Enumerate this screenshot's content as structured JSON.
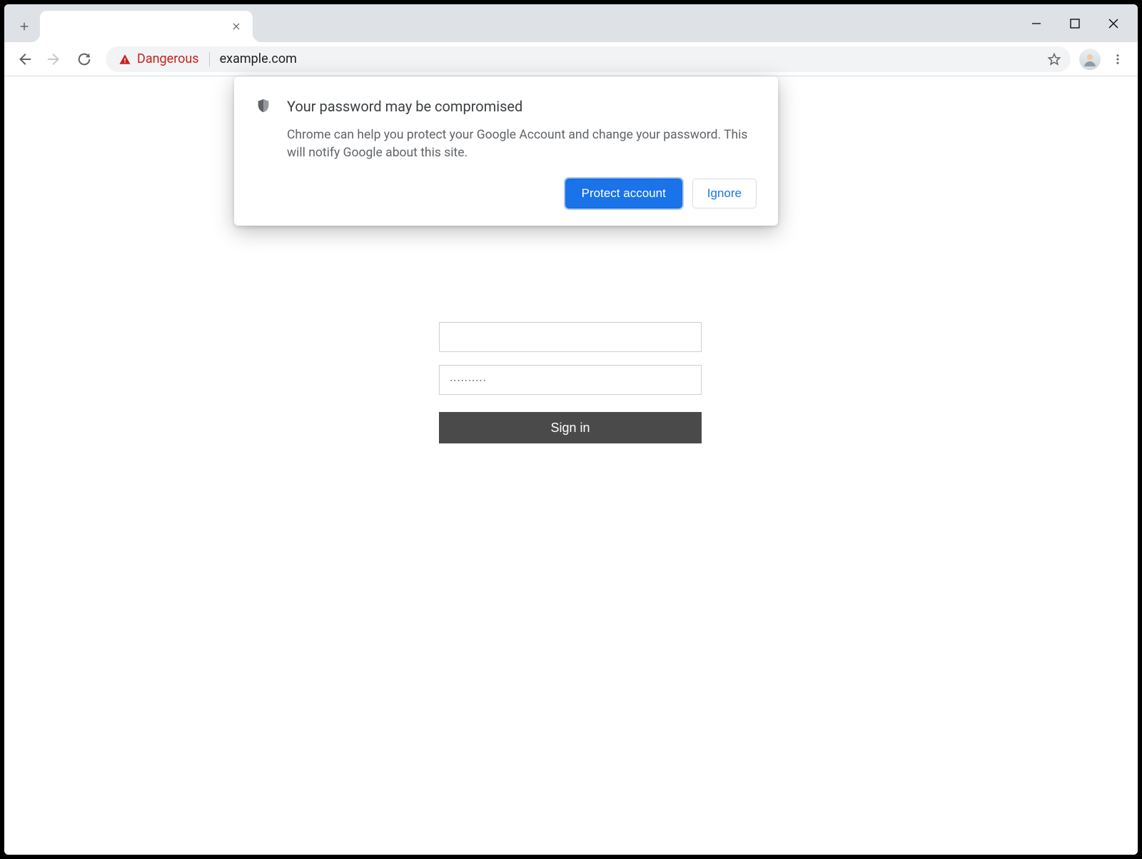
{
  "omnibox": {
    "security_label": "Dangerous",
    "url": "example.com"
  },
  "bubble": {
    "title": "Your password may be compromised",
    "body": "Chrome can help you protect your Google Account and change your password. This will notify Google about this site.",
    "primary": "Protect account",
    "secondary": "Ignore"
  },
  "login": {
    "username_value": "",
    "password_masked": "∙∙∙∙∙∙∙∙∙∙",
    "signin_label": "Sign in"
  }
}
